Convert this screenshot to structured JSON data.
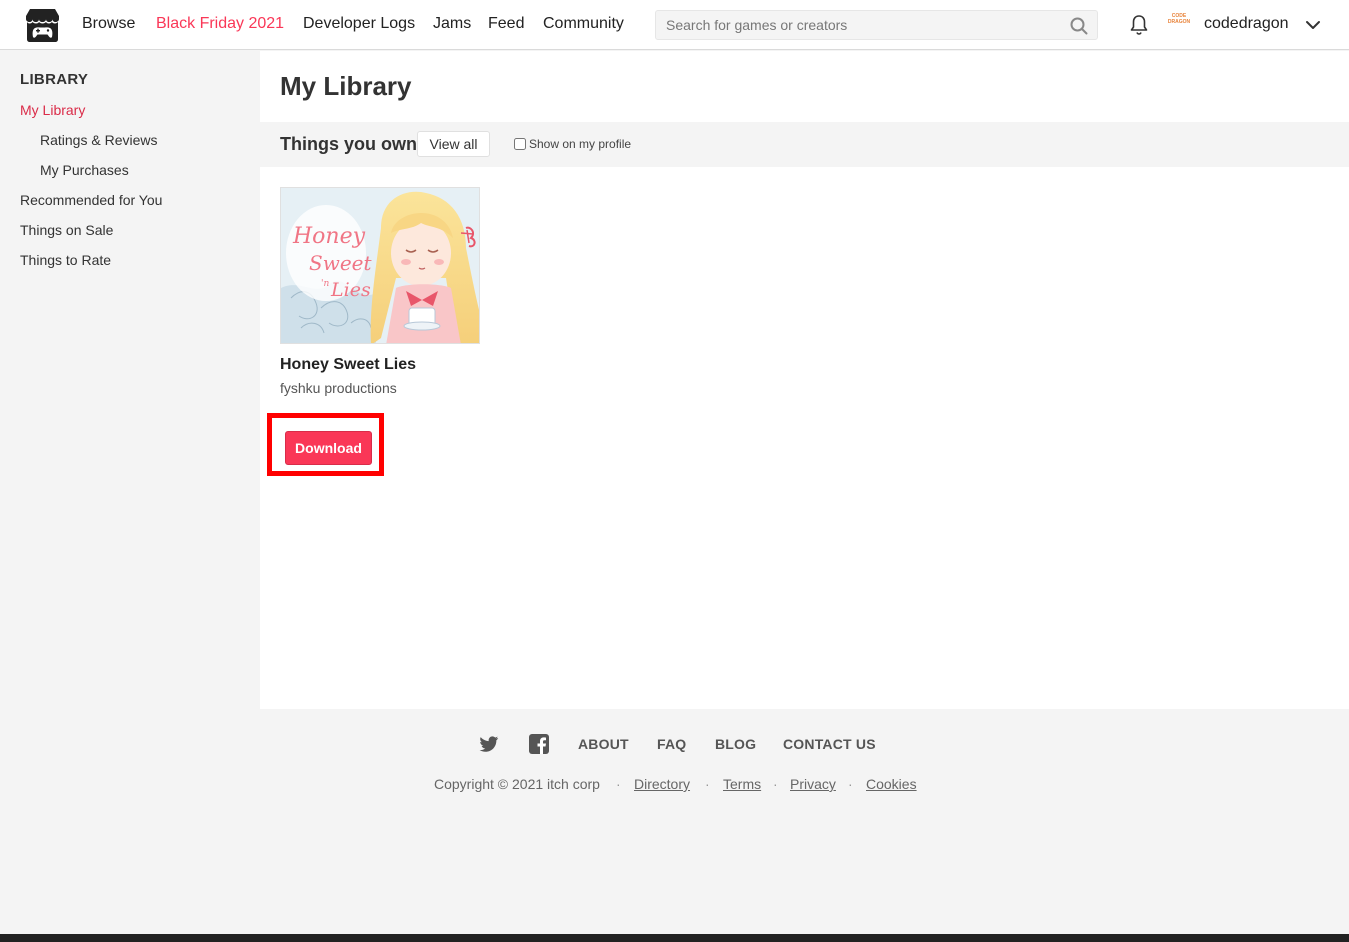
{
  "header": {
    "nav": [
      "Browse",
      "Black Friday 2021",
      "Developer Logs",
      "Jams",
      "Feed",
      "Community"
    ],
    "search_placeholder": "Search for games or creators",
    "avatar_text": "CODE DRAGON",
    "username": "codedragon"
  },
  "sidebar": {
    "heading": "LIBRARY",
    "items": [
      "My Library",
      "Ratings & Reviews",
      "My Purchases",
      "Recommended for You",
      "Things on Sale",
      "Things to Rate"
    ]
  },
  "main": {
    "title": "My Library",
    "section_title": "Things you own",
    "view_all": "View all",
    "show_on_profile": "Show on my profile",
    "game": {
      "cover_text": [
        "Honey",
        "Sweet",
        "'n",
        "Lies"
      ],
      "title": "Honey Sweet Lies",
      "author": "fyshku productions",
      "download_label": "Download"
    }
  },
  "footer": {
    "links": [
      "ABOUT",
      "FAQ",
      "BLOG",
      "CONTACT US"
    ],
    "copyright": "Copyright © 2021 itch corp",
    "legal": [
      "Directory",
      "Terms",
      "Privacy",
      "Cookies"
    ],
    "separator": "·"
  },
  "colors": {
    "accent": "#fa3757",
    "active_link": "#da2c49",
    "highlight_frame": "#ff0000"
  }
}
